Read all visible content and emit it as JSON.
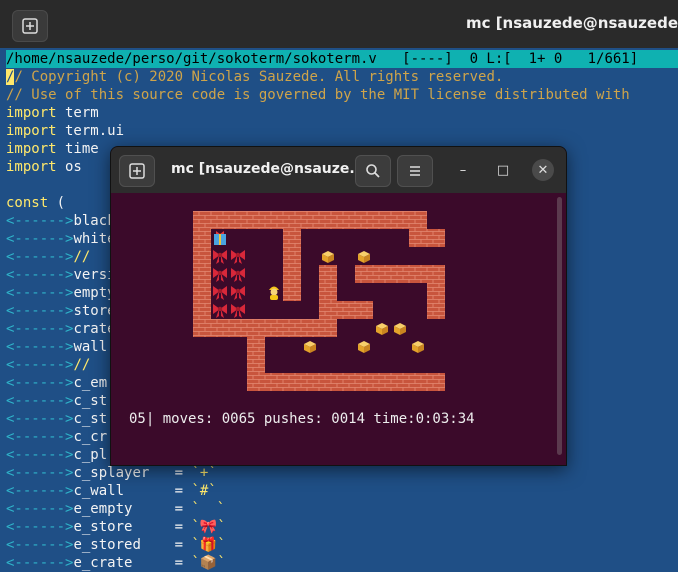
{
  "back_window": {
    "title": "mc [nsauzede@nsauzede",
    "status_bar": "/home/nsauzede/perso/git/sokoterm/sokoterm.v   [----]  0 L:[  1+ 0   1/661]",
    "lines": [
      {
        "type": "comment-cursor",
        "cursor": "/",
        "text": "/ Copyright (c) 2020 Nicolas Sauzede. All rights reserved."
      },
      {
        "type": "comment",
        "text": "// Use of this source code is governed by the MIT license distributed with"
      },
      {
        "type": "import",
        "kw": "import",
        "rest": " term"
      },
      {
        "type": "import",
        "kw": "import",
        "rest": " term.ui"
      },
      {
        "type": "import",
        "kw": "import",
        "rest": " time"
      },
      {
        "type": "import",
        "kw": "import",
        "rest": " os"
      },
      {
        "type": "blank"
      },
      {
        "type": "const",
        "kw": "const",
        "rest": " ("
      },
      {
        "type": "tab",
        "tab": "<------>",
        "rest": "black"
      },
      {
        "type": "tab",
        "tab": "<------>",
        "rest": "white"
      },
      {
        "type": "tabc",
        "tab": "<------>",
        "rest": "//"
      },
      {
        "type": "tab",
        "tab": "<------>",
        "rest": "versi"
      },
      {
        "type": "tab",
        "tab": "<------>",
        "rest": "empty"
      },
      {
        "type": "tab",
        "tab": "<------>",
        "rest": "store"
      },
      {
        "type": "tab",
        "tab": "<------>",
        "rest": "crate"
      },
      {
        "type": "tab",
        "tab": "<------>",
        "rest": "wall"
      },
      {
        "type": "tabc",
        "tab": "<------>",
        "rest": "//"
      },
      {
        "type": "tab",
        "tab": "<------>",
        "rest": "c_em"
      },
      {
        "type": "tab",
        "tab": "<------>",
        "rest": "c_st"
      },
      {
        "type": "tab",
        "tab": "<------>",
        "rest": "c_st"
      },
      {
        "type": "tab",
        "tab": "<------>",
        "rest": "c_cr"
      },
      {
        "type": "tab",
        "tab": "<------>",
        "rest": "c_pl"
      },
      {
        "type": "assign",
        "tab": "<------>",
        "rest": "c_splayer   = ",
        "val": "`+`"
      },
      {
        "type": "assign",
        "tab": "<------>",
        "rest": "c_wall      = ",
        "val": "`#`"
      },
      {
        "type": "assign",
        "tab": "<------>",
        "rest": "e_empty     = ",
        "val": "`  `"
      },
      {
        "type": "assign",
        "tab": "<------>",
        "rest": "e_store     = ",
        "val": "`🎀`"
      },
      {
        "type": "assign",
        "tab": "<------>",
        "rest": "e_stored    = ",
        "val": "`🎁`"
      },
      {
        "type": "assign",
        "tab": "<------>",
        "rest": "e_crate     = ",
        "val": "`📦`"
      }
    ]
  },
  "front_window": {
    "title": "mc [nsauzede@nsauze...",
    "search_label": "search",
    "menu_label": "menu",
    "minimize_label": "–",
    "maximize_label": "□",
    "close_label": "✕"
  },
  "game": {
    "level": "05",
    "moves": "0065",
    "pushes": "0014",
    "time": "0:03:34",
    "status_text": "05| moves: 0065 pushes: 0014 time:0:03:34",
    "map": [
      "#############   ",
      "#S   #      ### ",
      "#SS  # C C    # ",
      "#SS  # # ######C# ",
      "#SS @# #     # #",
      "#SS    ###   # #",
      "########  CC   #",
      "   #  C  C  C  C#",
      "   #           #",
      "   #############"
    ]
  },
  "colors": {
    "terminal_bg": "#1f4f86",
    "front_bg": "#3b0a2a",
    "status_bar": "#0fb1b1",
    "wall": "#c8553d",
    "crate": "#f2b233"
  }
}
